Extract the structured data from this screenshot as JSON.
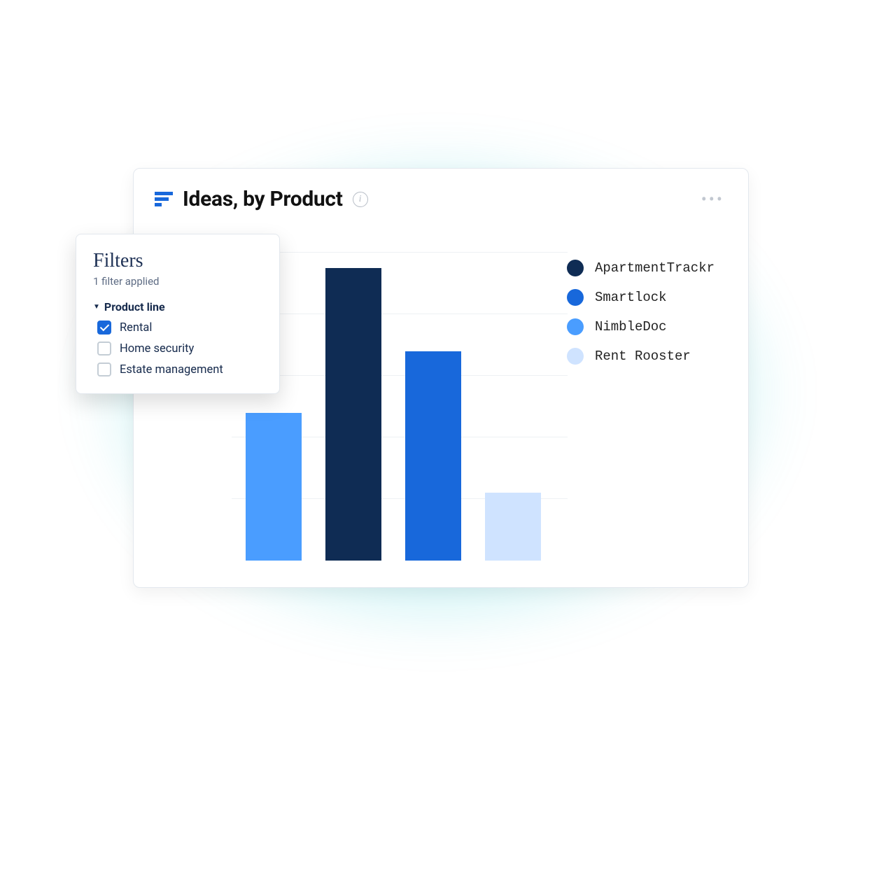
{
  "card": {
    "title": "Ideas, by Product"
  },
  "filters": {
    "title": "Filters",
    "subtitle": "1 filter applied",
    "group_label": "Product line",
    "options": [
      {
        "label": "Rental",
        "checked": true
      },
      {
        "label": "Home security",
        "checked": false
      },
      {
        "label": "Estate management",
        "checked": false
      }
    ]
  },
  "legend": [
    {
      "label": "ApartmentTrackr",
      "color": "#0f2c54"
    },
    {
      "label": "Smartlock",
      "color": "#1868db"
    },
    {
      "label": "NimbleDoc",
      "color": "#4a9dff"
    },
    {
      "label": "Rent Rooster",
      "color": "#cfe3ff"
    }
  ],
  "chart_data": {
    "type": "bar",
    "title": "Ideas, by Product",
    "xlabel": "",
    "ylabel": "",
    "ylim": [
      0,
      100
    ],
    "gridlines": [
      20,
      40,
      60,
      80,
      100
    ],
    "categories": [
      "NimbleDoc",
      "ApartmentTrackr",
      "Smartlock",
      "Rent Rooster"
    ],
    "values": [
      48,
      95,
      68,
      22
    ],
    "colors": [
      "#4a9dff",
      "#0f2c54",
      "#1868db",
      "#cfe3ff"
    ]
  }
}
